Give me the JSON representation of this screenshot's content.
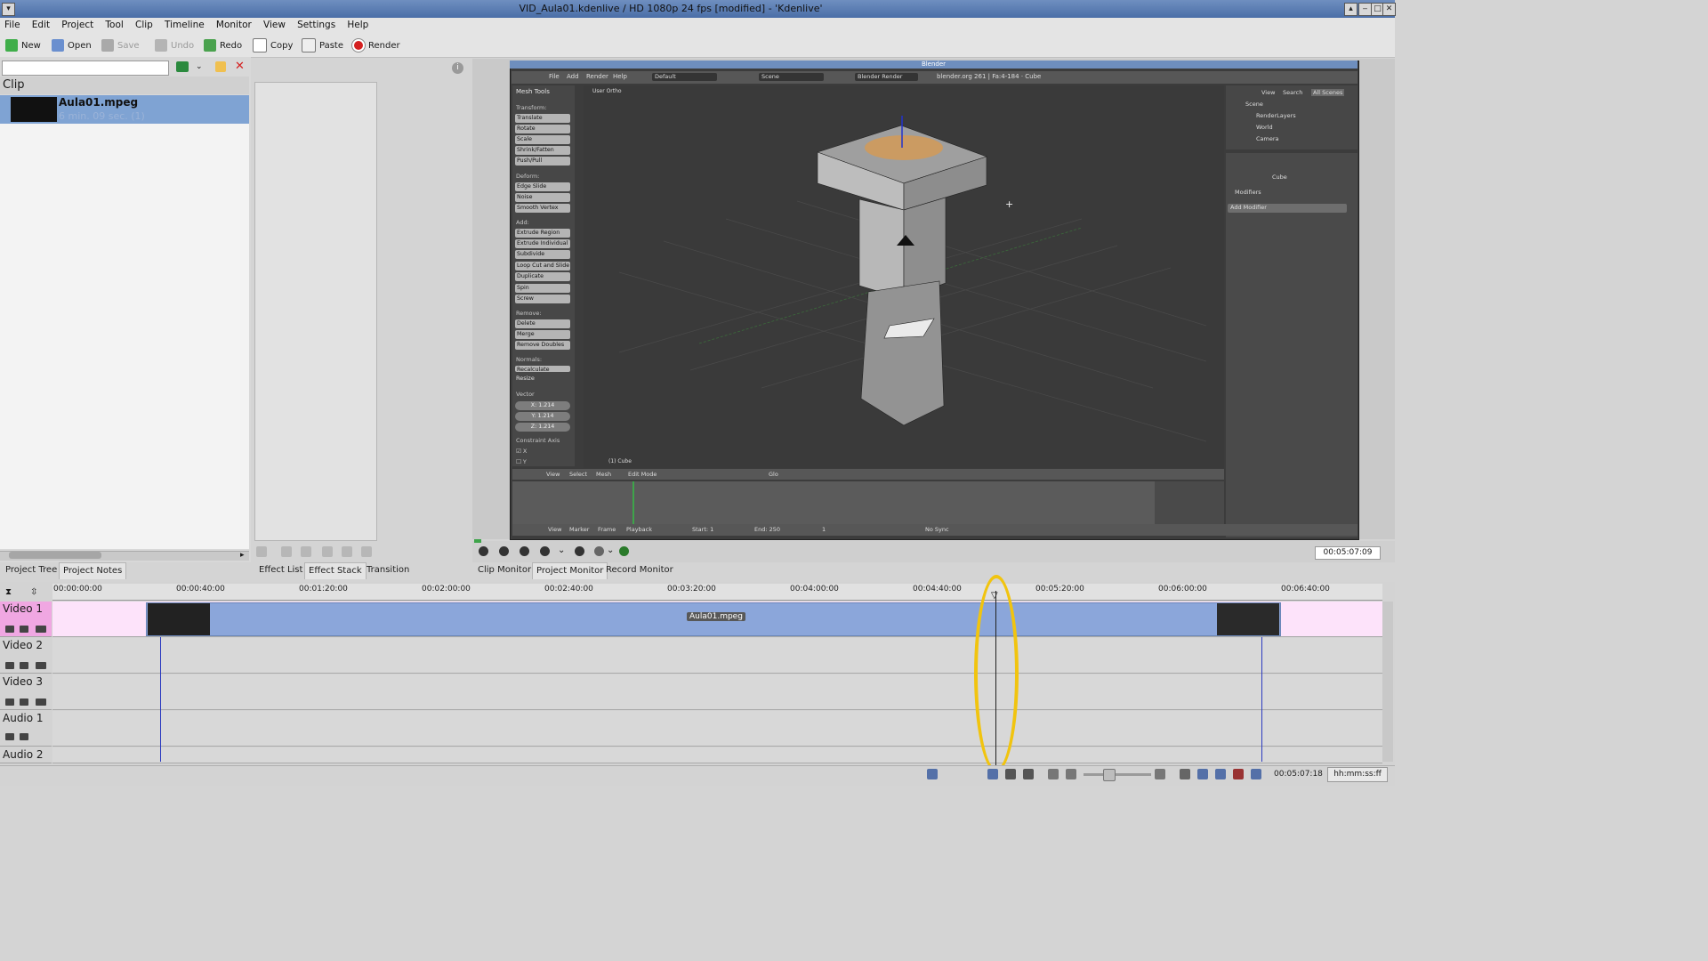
{
  "window": {
    "title": "VID_Aula01.kdenlive / HD 1080p 24 fps [modified] - 'Kdenlive'"
  },
  "menu": [
    "File",
    "Edit",
    "Project",
    "Tool",
    "Clip",
    "Timeline",
    "Monitor",
    "View",
    "Settings",
    "Help"
  ],
  "toolbar": {
    "new": "New",
    "open": "Open",
    "save": "Save",
    "undo": "Undo",
    "redo": "Redo",
    "copy": "Copy",
    "paste": "Paste",
    "render": "Render"
  },
  "bin": {
    "header": "Clip",
    "clip_name": "Aula01.mpeg",
    "clip_info": "6 min. 09 sec. (1)"
  },
  "left_tabs": [
    "Project Tree",
    "Project Notes"
  ],
  "effect_tabs": [
    "Effect List",
    "Effect Stack",
    "Transition"
  ],
  "monitor_tabs": [
    "Clip Monitor",
    "Project Monitor",
    "Record Monitor"
  ],
  "monitor": {
    "timecode": "00:05:07:09"
  },
  "blender": {
    "title": "Blender",
    "menu": [
      "File",
      "Add",
      "Render",
      "Help"
    ],
    "layout": "Default",
    "scene": "Scene",
    "engine": "Blender Render",
    "info": "blender.org 261 | Fa:4-184 · Cube",
    "tools_title": "Mesh Tools",
    "sections": {
      "transform": "Transform:",
      "deform": "Deform:",
      "add": "Add:",
      "remove": "Remove:",
      "normals": "Normals:",
      "resize": "Resize",
      "vector": "Vector",
      "constraint": "Constraint Axis"
    },
    "transform_btns": [
      "Translate",
      "Rotate",
      "Scale",
      "Shrink/Fatten",
      "Push/Pull"
    ],
    "deform_btns": [
      "Edge Slide",
      "Noise",
      "Smooth Vertex"
    ],
    "add_btns": [
      "Extrude Region",
      "Extrude Individual",
      "Subdivide",
      "Loop Cut and Slide",
      "Duplicate",
      "Spin",
      "Screw"
    ],
    "remove_btns": [
      "Delete",
      "Merge",
      "Remove Doubles"
    ],
    "normals_btn": "Recalculate",
    "vector": [
      "X: 1.214",
      "Y: 1.214",
      "Z: 1.214"
    ],
    "axes": [
      "X",
      "Y"
    ],
    "viewport_label": "User Ortho",
    "viewport_object": "(1) Cube",
    "outliner_menu": [
      "View",
      "Search",
      "All Scenes"
    ],
    "outliner": [
      "Scene",
      "RenderLayers",
      "World",
      "Camera"
    ],
    "props_object": "Cube",
    "modifiers": "Modifiers",
    "add_modifier": "Add Modifier",
    "bottom_menu": [
      "View",
      "Select",
      "Mesh"
    ],
    "mode": "Edit Mode",
    "pivot": "Glo",
    "timeline_menu": [
      "View",
      "Marker",
      "Frame",
      "Playback"
    ],
    "start": "Start: 1",
    "end": "End: 250",
    "frame": "1",
    "sync": "No Sync"
  },
  "timeline": {
    "ruler": [
      "00:00:00:00",
      "00:00:40:00",
      "00:01:20:00",
      "00:02:00:00",
      "00:02:40:00",
      "00:03:20:00",
      "00:04:00:00",
      "00:04:40:00",
      "00:05:20:00",
      "00:06:00:00",
      "00:06:40:00"
    ],
    "tracks": [
      "Video 1",
      "Video 2",
      "Video 3",
      "Audio 1",
      "Audio 2"
    ],
    "clip_label": "Aula01.mpeg"
  },
  "status": {
    "time": "00:05:07:18",
    "format": "hh:mm:ss:ff"
  },
  "colors": {
    "clip": "#8ba6da",
    "video1_track": "#f0a7e2",
    "highlight": "#f1c40f",
    "selection": "#7fa3d3"
  }
}
